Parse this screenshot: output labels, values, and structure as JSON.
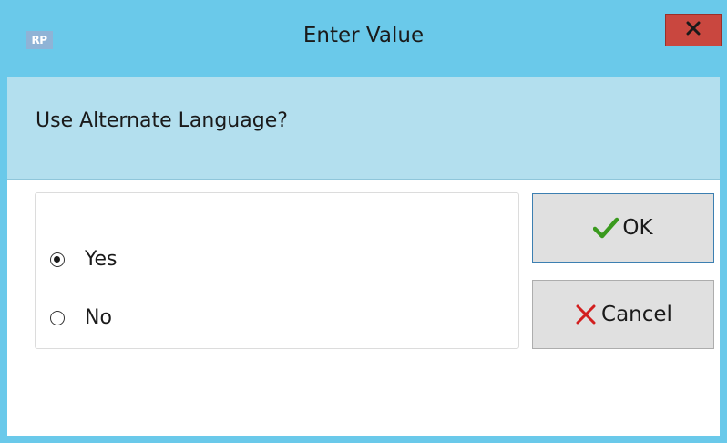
{
  "window": {
    "title": "Enter Value",
    "app_icon_text": "RP",
    "close_icon": "close-icon"
  },
  "prompt": {
    "text": "Use Alternate Language?"
  },
  "options": [
    {
      "label": "Yes",
      "selected": true
    },
    {
      "label": "No",
      "selected": false
    }
  ],
  "buttons": {
    "ok_label": "OK",
    "ok_icon": "checkmark-icon",
    "cancel_label": "Cancel",
    "cancel_icon": "x-icon"
  },
  "colors": {
    "titlebar": "#6ac9ea",
    "prompt_band": "#b3dfee",
    "close_button": "#c9473f",
    "ok_check": "#3a9a1e",
    "cancel_x": "#d21f1f"
  }
}
